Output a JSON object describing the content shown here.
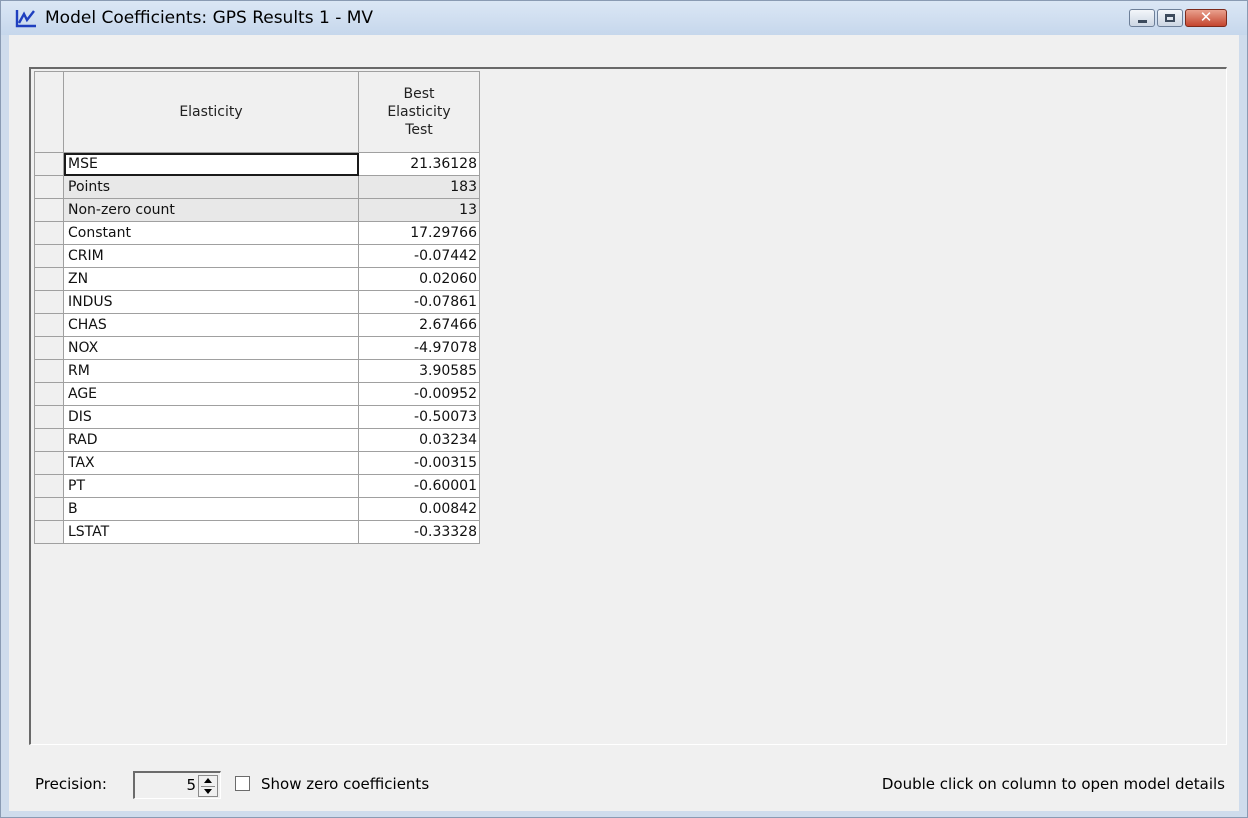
{
  "window": {
    "title": "Model Coefficients: GPS Results 1 - MV",
    "close_glyph": "✕"
  },
  "icons": {
    "app": "line-chart-icon",
    "minimize": "minimize-icon",
    "maximize": "maximize-icon",
    "close": "close-icon",
    "spin_up": "arrow-up-icon",
    "spin_down": "arrow-down-icon"
  },
  "grid": {
    "header_name": "Elasticity",
    "header_value": "Best Elasticity Test",
    "rows": [
      {
        "name": "MSE",
        "value": "21.36128"
      },
      {
        "name": "Points",
        "value": "183"
      },
      {
        "name": "Non-zero count",
        "value": "13"
      },
      {
        "name": "Constant",
        "value": "17.29766"
      },
      {
        "name": "CRIM",
        "value": "-0.07442"
      },
      {
        "name": "ZN",
        "value": "0.02060"
      },
      {
        "name": "INDUS",
        "value": "-0.07861"
      },
      {
        "name": "CHAS",
        "value": "2.67466"
      },
      {
        "name": "NOX",
        "value": "-4.97078"
      },
      {
        "name": "RM",
        "value": "3.90585"
      },
      {
        "name": "AGE",
        "value": "-0.00952"
      },
      {
        "name": "DIS",
        "value": "-0.50073"
      },
      {
        "name": "RAD",
        "value": "0.03234"
      },
      {
        "name": "TAX",
        "value": "-0.00315"
      },
      {
        "name": "PT",
        "value": "-0.60001"
      },
      {
        "name": "B",
        "value": "0.00842"
      },
      {
        "name": "LSTAT",
        "value": "-0.33328"
      }
    ]
  },
  "footer": {
    "precision_label": "Precision:",
    "precision_value": "5",
    "show_zero_label": "Show zero coefficients",
    "show_zero_checked": false,
    "hint": "Double click on column to open model details"
  },
  "colors": {
    "title_bg": "#c6d7ec",
    "close_button": "#c4452e",
    "app_icon": "#1f3fbf",
    "client_bg": "#f0f0f0",
    "shaded_row": "#e8e8e8"
  }
}
